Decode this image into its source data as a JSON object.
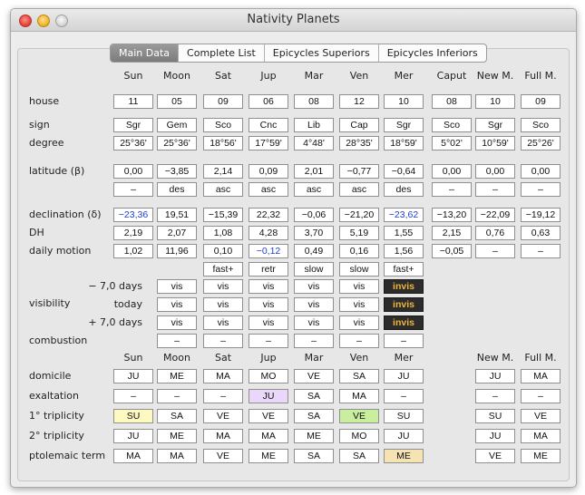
{
  "window": {
    "title": "Nativity Planets"
  },
  "tabs": [
    "Main Data",
    "Complete List",
    "Epicycles Superiors",
    "Epicycles Inferiors"
  ],
  "active_tab": "Main Data",
  "columns": [
    "Sun",
    "Moon",
    "Sat",
    "Jup",
    "Mar",
    "Ven",
    "Mer",
    "Caput",
    "New M.",
    "Full M."
  ],
  "rows": {
    "house": {
      "label": "house",
      "values": [
        "11",
        "05",
        "09",
        "06",
        "08",
        "12",
        "10",
        "08",
        "10",
        "09"
      ]
    },
    "sign": {
      "label": "sign",
      "values": [
        "Sgr",
        "Gem",
        "Sco",
        "Cnc",
        "Lib",
        "Cap",
        "Sgr",
        "Sco",
        "Sgr",
        "Sco"
      ]
    },
    "degree": {
      "label": "degree",
      "values": [
        "25°36'",
        "25°36'",
        "18°56'",
        "17°59'",
        "4°48'",
        "28°35'",
        "18°59'",
        "5°02'",
        "10°59'",
        "25°26'"
      ]
    },
    "latitude": {
      "label": "latitude (β)",
      "values": [
        "0,00",
        "−3,85",
        "2,14",
        "0,09",
        "2,01",
        "−0,77",
        "−0,64",
        "0,00",
        "0,00",
        "0,00"
      ]
    },
    "latitude_dir": {
      "label": "",
      "values": [
        "–",
        "des",
        "asc",
        "asc",
        "asc",
        "asc",
        "des",
        "–",
        "–",
        "–"
      ]
    },
    "declination": {
      "label": "declination (δ)",
      "values": [
        "−23,36",
        "19,51",
        "−15,39",
        "22,32",
        "−0,06",
        "−21,20",
        "−23,62",
        "−13,20",
        "−22,09",
        "−19,12"
      ]
    },
    "dh": {
      "label": "DH",
      "values": [
        "2,19",
        "2,07",
        "1,08",
        "4,28",
        "3,70",
        "5,19",
        "1,55",
        "2,15",
        "0,76",
        "0,63"
      ]
    },
    "daily_motion": {
      "label": "daily motion",
      "values": [
        "1,02",
        "11,96",
        "0,10",
        "−0,12",
        "0,49",
        "0,16",
        "1,56",
        "−0,05",
        "–",
        "–"
      ]
    },
    "motion_type": {
      "label": "",
      "values": [
        "fast+",
        "retr",
        "slow",
        "slow",
        "fast+"
      ]
    }
  },
  "visibility": {
    "label": "visibility",
    "rows": [
      {
        "label": "− 7,0 days",
        "values": [
          "vis",
          "vis",
          "vis",
          "vis",
          "vis",
          "invis"
        ]
      },
      {
        "label": "today",
        "values": [
          "vis",
          "vis",
          "vis",
          "vis",
          "vis",
          "invis"
        ]
      },
      {
        "label": "+ 7,0 days",
        "values": [
          "vis",
          "vis",
          "vis",
          "vis",
          "vis",
          "invis"
        ]
      }
    ]
  },
  "combustion": {
    "label": "combustion",
    "values": [
      "–",
      "–",
      "–",
      "–",
      "–",
      "–"
    ]
  },
  "dignity_columns": [
    "Sun",
    "Moon",
    "Sat",
    "Jup",
    "Mar",
    "Ven",
    "Mer",
    "New M.",
    "Full M."
  ],
  "dignities": [
    {
      "label": "domicile",
      "values": [
        "JU",
        "ME",
        "MA",
        "MO",
        "VE",
        "SA",
        "JU",
        "JU",
        "MA"
      ]
    },
    {
      "label": "exaltation",
      "values": [
        "–",
        "–",
        "–",
        "JU",
        "SA",
        "MA",
        "–",
        "–",
        "–"
      ]
    },
    {
      "label": "1° triplicity",
      "values": [
        "SU",
        "SA",
        "VE",
        "VE",
        "SA",
        "VE",
        "SU",
        "SU",
        "VE"
      ]
    },
    {
      "label": "2° triplicity",
      "values": [
        "JU",
        "ME",
        "MA",
        "MA",
        "ME",
        "MO",
        "JU",
        "JU",
        "MA"
      ]
    },
    {
      "label": "ptolemaic term",
      "values": [
        "MA",
        "MA",
        "VE",
        "ME",
        "SA",
        "SA",
        "ME",
        "VE",
        "ME"
      ]
    }
  ],
  "colors": {
    "blue_text": "#1f3fd6",
    "invis_bg": "#2c2c2c",
    "invis_text": "#f2b43a",
    "highlight_yellow": "#fdf9c0",
    "highlight_lavender": "#ead8fb",
    "highlight_green": "#c9ee9e",
    "highlight_tan": "#f5e3b4"
  }
}
